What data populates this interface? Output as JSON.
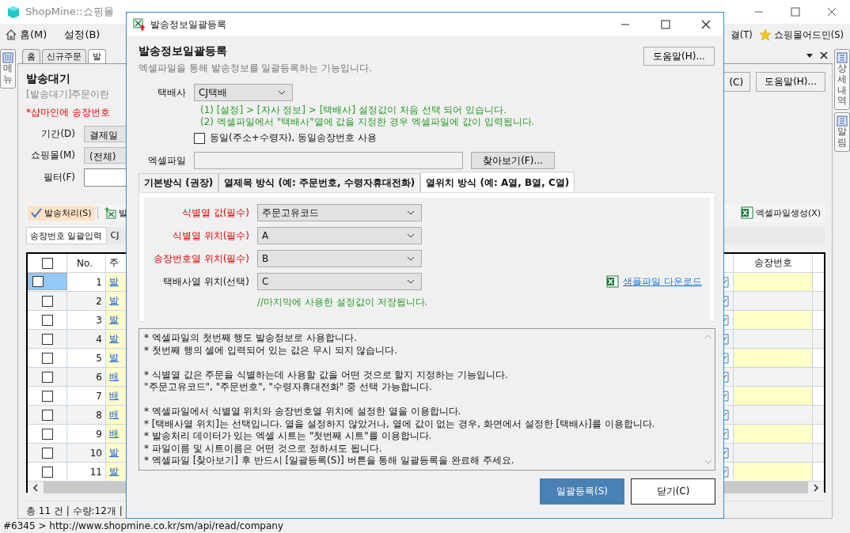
{
  "app": {
    "title": "ShopMine::쇼핑몰",
    "menu": [
      {
        "label": "홈(M)",
        "kind": "home"
      },
      {
        "label": "설정(B)",
        "kind": "plain"
      }
    ],
    "menu_right": "결(T)",
    "admin": "쇼핑몰어드민(S)"
  },
  "left_dock": {
    "label": "메뉴"
  },
  "right_dock": [
    {
      "label": "상세내역"
    },
    {
      "label": "알림"
    }
  ],
  "doc_tabs": [
    {
      "label": "홈",
      "selected": false
    },
    {
      "label": "신규주문",
      "selected": false
    },
    {
      "label": "발",
      "selected": true
    }
  ],
  "page": {
    "title": "발송대기",
    "description": "[발송대기]주문이란",
    "notice": "*샵마인에 송장번호",
    "filters": [
      {
        "label": "기간(D)",
        "value": "결제일",
        "kind": "select"
      },
      {
        "label": "쇼핑몰(M)",
        "value": "(전체)",
        "kind": "select"
      },
      {
        "label": "필터(F)",
        "kind": "input"
      }
    ],
    "buttons": [
      "(C)",
      "도움말(H)..."
    ]
  },
  "toolbar": {
    "left": [
      {
        "label": "발송처리(S)",
        "kind": "process",
        "selected": true
      },
      {
        "label": "발",
        "kind": "upload",
        "selected": false
      }
    ],
    "right": {
      "label": "엑셀파일생성(X)"
    }
  },
  "subtabs": [
    {
      "label": "송장번호 일괄입력",
      "selected": true
    },
    {
      "label": "CJ",
      "selected": false
    }
  ],
  "table": {
    "columns": [
      "No.",
      "주",
      "송장번호"
    ],
    "select_all_checked": false,
    "rows": [
      {
        "no": "1",
        "order": "발",
        "selected": true,
        "checked": false
      },
      {
        "no": "2",
        "order": "발",
        "selected": false,
        "checked": false
      },
      {
        "no": "3",
        "order": "발",
        "selected": false,
        "checked": false
      },
      {
        "no": "4",
        "order": "발",
        "selected": false,
        "checked": false
      },
      {
        "no": "5",
        "order": "발",
        "selected": false,
        "checked": false
      },
      {
        "no": "6",
        "order": "배",
        "selected": false,
        "checked": false
      },
      {
        "no": "7",
        "order": "배",
        "selected": false,
        "checked": false
      },
      {
        "no": "8",
        "order": "배",
        "selected": false,
        "checked": false
      },
      {
        "no": "9",
        "order": "배",
        "selected": false,
        "checked": false
      },
      {
        "no": "10",
        "order": "발",
        "selected": false,
        "checked": false
      },
      {
        "no": "11",
        "order": "발",
        "selected": false,
        "checked": false
      }
    ]
  },
  "footer": "총 11 건 | 수량:12개 |",
  "status_bar": "#6345 > http://www.shopmine.co.kr/sm/api/read/company",
  "dialog": {
    "title": "발송정보일괄등록",
    "heading": "발송정보일괄등록",
    "subtitle": "엑셀파일을 통해 발송정보를 일괄등록하는 기능입니다.",
    "help_button": "도움말(H)...",
    "carrier": {
      "label": "택배사",
      "value": "CJ택배"
    },
    "notes": [
      "(1) [설정] > [자사 정보] > [택배사] 설정값이 처음 선택 되어 있습니다.",
      "(2) 엑셀파일에서 \"택배사\"열에 값을 지정한 경우 엑셀파일에 값이 입력됩니다."
    ],
    "same_invoice": {
      "label": "동일(주소+수령자), 동일송장번호 사용",
      "checked": false
    },
    "excel_file": {
      "label": "엑셀파일",
      "browse_button": "찾아보기(F)..."
    },
    "tabs": [
      {
        "label": "기본방식 (권장)",
        "selected": false
      },
      {
        "label": "열제목 방식 (예: 주문번호, 수령자휴대전화)",
        "selected": false
      },
      {
        "label": "열위치 방식 (예: A열, B열, C열)",
        "selected": true
      }
    ],
    "fields": [
      {
        "label": "식별열 값(필수)",
        "value": "주문고유코드",
        "required": true
      },
      {
        "label": "식별열 위치(필수)",
        "value": "A",
        "required": true
      },
      {
        "label": "송장번호열 위치(필수)",
        "value": "B",
        "required": true
      },
      {
        "label": "택배사열 위치(선택)",
        "value": "C",
        "required": false
      }
    ],
    "sample_link": "샘플파일 다운로드",
    "saved_note": "//마지막에 사용한 설정값이 저장됩니다.",
    "info": [
      [
        "* 엑셀파일의 첫번째 행도 발송정보로 사용합니다.",
        "* 첫번째 행의 셀에 입력되어 있는 값은 무시 되지 않습니다."
      ],
      [
        "* 식별열 값은 주문을 식별하는데 사용할 값을 어떤 것으로 할지 지정하는 기능입니다.",
        "\"주문고유코드\", \"주문번호\", \"수령자휴대전화\" 중 선택 가능합니다."
      ],
      [
        "* 엑셀파일에서 식별열 위치와 송장번호열 위치에 설정한 열을 이용합니다.",
        "* [택배사열 위치]는 선택입니다. 열을 설정하지 않았거나, 열에 값이 없는 경우, 화면에서 설정한 [택배사]를 이용합니다.",
        "* 발송처리 데이터가 있는 엑셀 시트는 \"첫번째 시트\"를 이용합니다.",
        "* 파일이름 및 시트이름은 어떤 것으로 정하셔도 됩니다.",
        "* 엑셀파일 [찾아보기] 후 반드시 [일괄등록(S)] 버튼을 통해 일괄등록을 완료해 주세요."
      ]
    ],
    "buttons": [
      {
        "label": "일괄등록(S)",
        "kind": "primary"
      },
      {
        "label": "닫기(C)",
        "kind": "default"
      }
    ]
  }
}
